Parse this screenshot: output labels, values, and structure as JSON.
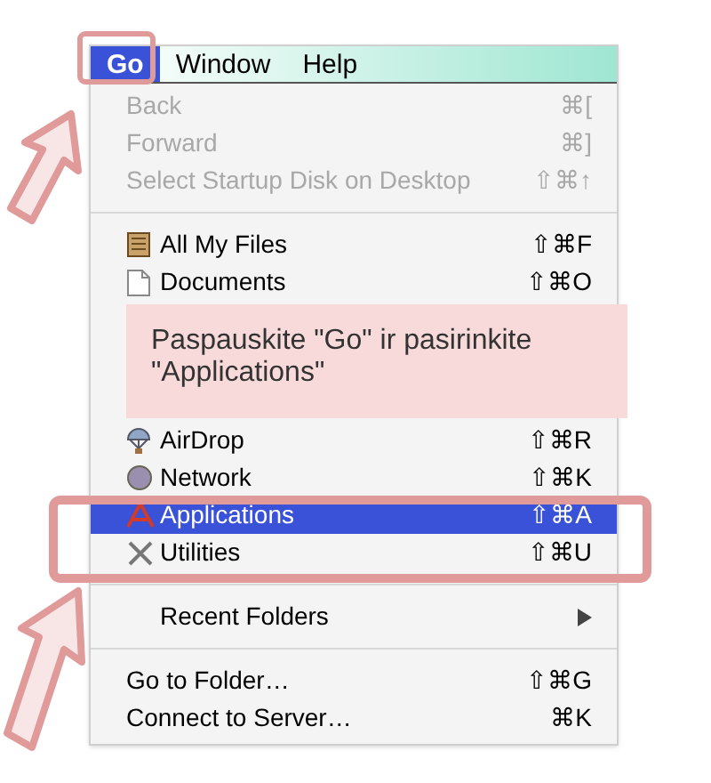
{
  "menubar": [
    {
      "label": "Go",
      "selected": true
    },
    {
      "label": "Window",
      "selected": false
    },
    {
      "label": "Help",
      "selected": false
    }
  ],
  "items": [
    {
      "kind": "item",
      "label": "Back",
      "shortcut": "⌘[",
      "disabled": true,
      "selected": false
    },
    {
      "kind": "item",
      "label": "Forward",
      "shortcut": "⌘]",
      "disabled": true,
      "selected": false
    },
    {
      "kind": "item",
      "label": "Select Startup Disk on Desktop",
      "shortcut": "⇧⌘↑",
      "disabled": true,
      "selected": false
    },
    {
      "kind": "separator"
    },
    {
      "kind": "item",
      "label": "All My Files",
      "shortcut": "⇧⌘F",
      "disabled": false,
      "selected": false
    },
    {
      "kind": "item",
      "label": "Documents",
      "shortcut": "⇧⌘O",
      "disabled": false,
      "selected": false
    },
    {
      "kind": "callout",
      "text": "Paspauskite \"Go\" ir pasirinkite \"Applications\""
    },
    {
      "kind": "item",
      "label": "AirDrop",
      "shortcut": "⇧⌘R",
      "disabled": false,
      "selected": false
    },
    {
      "kind": "item",
      "label": "Network",
      "shortcut": "⇧⌘K",
      "disabled": false,
      "selected": false
    },
    {
      "kind": "item",
      "label": "Applications",
      "shortcut": "⇧⌘A",
      "disabled": false,
      "selected": true
    },
    {
      "kind": "item",
      "label": "Utilities",
      "shortcut": "⇧⌘U",
      "disabled": false,
      "selected": false
    },
    {
      "kind": "separator"
    },
    {
      "kind": "submenu",
      "label": "Recent Folders",
      "disabled": false,
      "selected": false
    },
    {
      "kind": "separator"
    },
    {
      "kind": "item",
      "label": "Go to Folder…",
      "shortcut": "⇧⌘G",
      "disabled": false,
      "selected": false
    },
    {
      "kind": "item",
      "label": "Connect to Server…",
      "shortcut": "⌘K",
      "disabled": false,
      "selected": false
    }
  ]
}
